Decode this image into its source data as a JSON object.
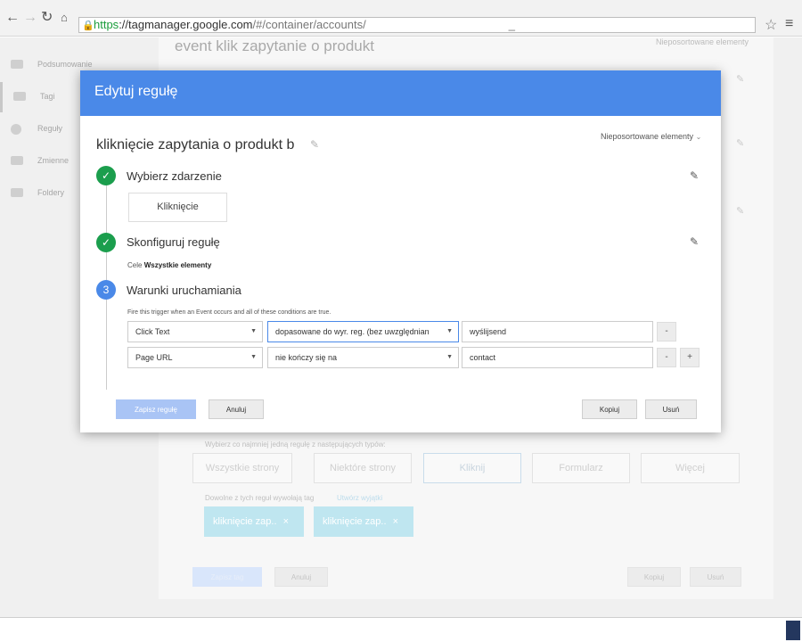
{
  "browser": {
    "url_scheme": "https",
    "url_host": "://tagmanager.google.com",
    "url_path": "/#/container/accounts/",
    "url_suffix": "_",
    "back_icon": "arrow-left",
    "forward_icon": "arrow-right",
    "reload_icon": "reload",
    "home_icon": "home",
    "lock_icon": "lock",
    "star_icon": "star",
    "menu_icon": "menu"
  },
  "sidebar": {
    "items": [
      {
        "label": "Podsumowanie",
        "icon": "briefcase"
      },
      {
        "label": "Tagi",
        "icon": "tag"
      },
      {
        "label": "Reguły",
        "icon": "target"
      },
      {
        "label": "Zmienne",
        "icon": "lego"
      },
      {
        "label": "Foldery",
        "icon": "folder"
      }
    ]
  },
  "background": {
    "title": "event klik zapytanie o produkt",
    "sort_label": "Nieposortowane elementy",
    "choose_rule_text": "Wybierz co najmniej jedną regułę z następujących typów:",
    "rule_types": [
      "Wszystkie strony",
      "Niektóre strony",
      "Kliknij",
      "Formularz",
      "Więcej"
    ],
    "any_rule_text": "Dowolne z tych reguł wywołają tag",
    "exceptions_link": "Utwórz wyjątki",
    "chips": [
      "kliknięcie zap..",
      "kliknięcie zap.."
    ],
    "save_tag": "Zapisz tag",
    "cancel": "Anuluj",
    "copy": "Kopiuj",
    "delete": "Usuń"
  },
  "modal": {
    "title": "Edytuj regułę",
    "rule_name": "kliknięcie zapytania o produkt b",
    "sort_label": "Nieposortowane elementy",
    "steps": [
      {
        "number": "",
        "label": "Wybierz zdarzenie",
        "status": "done"
      },
      {
        "number": "",
        "label": "Skonfiguruj regułę",
        "status": "done"
      },
      {
        "number": "3",
        "label": "Warunki uruchamiania",
        "status": "current"
      }
    ],
    "event_button": "Kliknięcie",
    "cele_label": "Cele",
    "cele_value": "Wszystkie elementy",
    "fire_text": "Fire this trigger when an Event occurs and all of these conditions are true.",
    "conditions": [
      {
        "variable": "Click Text",
        "operator": "dopasowane do wyr. reg. (bez uwzględnian",
        "value": "wyślijsend"
      },
      {
        "variable": "Page URL",
        "operator": "nie kończy się na",
        "value": "contact"
      }
    ],
    "remove_label": "-",
    "add_label": "+",
    "save": "Zapisz regułę",
    "cancel": "Anuluj",
    "copy": "Kopiuj",
    "delete": "Usuń"
  },
  "colors": {
    "header_blue": "#4a89e8",
    "done_green": "#1b9e4d",
    "chip": "#bfe6f0"
  }
}
